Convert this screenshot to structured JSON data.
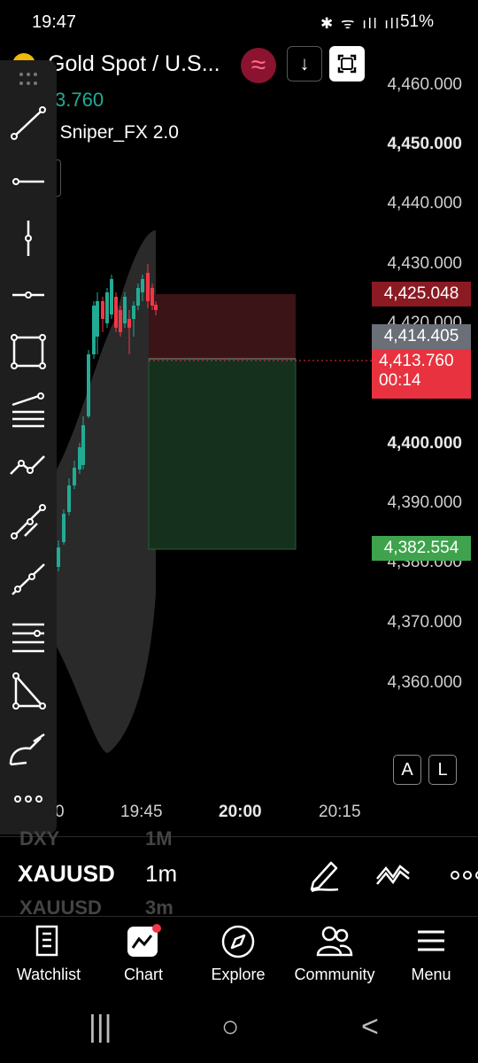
{
  "status_bar": {
    "time": "19:47",
    "icons": "✱ ᯤ ıll ıll",
    "battery": "51%"
  },
  "header": {
    "symbol_title": "Gold Spot / U.S...",
    "symbol_price": "3.760",
    "indicator": "] Sniper_FX 2.0",
    "wave_icon": "≈",
    "download_icon": "↓"
  },
  "price_axis": {
    "labels": [
      "4,460.000",
      "4,450.000",
      "4,440.000",
      "4,430.000",
      "4,400.000",
      "4,390.000",
      "4,370.000",
      "4,360.000"
    ],
    "partial_labels": [
      "4,420.000",
      "4,380.000"
    ],
    "badges": {
      "stop": {
        "value": "4,425.048",
        "color": "#8b1a22"
      },
      "entry": {
        "value": "4,414.405",
        "color": "#6b6f77"
      },
      "last": {
        "value": "4,413.760",
        "countdown": "00:14",
        "color": "#e8323f"
      },
      "target": {
        "value": "4,382.554",
        "color": "#3fa34d"
      }
    }
  },
  "time_axis": [
    "0",
    "19:45",
    "20:00",
    "20:15"
  ],
  "axis_buttons": {
    "a": "A",
    "l": "L"
  },
  "chart": {
    "colors": {
      "up": "#22ab94",
      "down": "#f23645",
      "risk_zone": "#3a1416",
      "reward_zone": "#15311d",
      "cloud": "#2a2a2a"
    }
  },
  "strip": {
    "ghost_top_symbol": "DXY",
    "ghost_top_interval": "1M",
    "symbol": "XAUUSD",
    "interval": "1m",
    "ghost_bottom_symbol": "XAUUSD",
    "ghost_bottom_interval": "3m"
  },
  "bottom_nav": [
    {
      "label": "Watchlist",
      "icon": "list-icon"
    },
    {
      "label": "Chart",
      "icon": "chart-icon"
    },
    {
      "label": "Explore",
      "icon": "compass-icon"
    },
    {
      "label": "Community",
      "icon": "people-icon"
    },
    {
      "label": "Menu",
      "icon": "hamburger-icon"
    }
  ],
  "system_nav": {
    "recents": "|||",
    "home": "○",
    "back": "<"
  }
}
